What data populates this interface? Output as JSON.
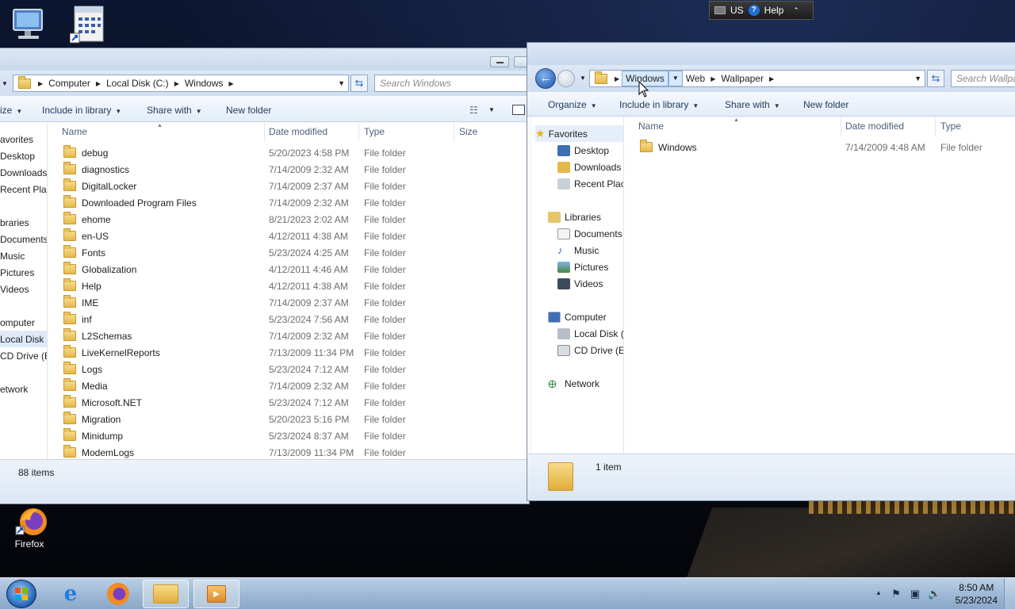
{
  "desktop": {
    "icons": [
      {
        "name": "computer-desktop-icon",
        "label": ""
      },
      {
        "name": "calendar-shortcut-icon",
        "label": ""
      },
      {
        "name": "firefox-desktop-icon",
        "label": "Firefox"
      }
    ]
  },
  "langbar": {
    "lang": "US",
    "help": "Help"
  },
  "left_window": {
    "breadcrumbs": [
      "Computer",
      "Local Disk (C:)",
      "Windows"
    ],
    "search_placeholder": "Search Windows",
    "toolbar": {
      "organize": "ize",
      "include": "Include in library",
      "share": "Share with",
      "new_folder": "New folder"
    },
    "columns": {
      "name": "Name",
      "date": "Date modified",
      "type": "Type",
      "size": "Size"
    },
    "nav": [
      "avorites",
      "Desktop",
      "Downloads",
      "Recent Plac",
      "braries",
      "Documents",
      "Music",
      "Pictures",
      "Videos",
      "omputer",
      "Local Disk (",
      "CD Drive (E:",
      "etwork"
    ],
    "rows": [
      {
        "name": "debug",
        "date": "5/20/2023 4:58 PM",
        "type": "File folder"
      },
      {
        "name": "diagnostics",
        "date": "7/14/2009 2:32 AM",
        "type": "File folder"
      },
      {
        "name": "DigitalLocker",
        "date": "7/14/2009 2:37 AM",
        "type": "File folder"
      },
      {
        "name": "Downloaded Program Files",
        "date": "7/14/2009 2:32 AM",
        "type": "File folder"
      },
      {
        "name": "ehome",
        "date": "8/21/2023 2:02 AM",
        "type": "File folder"
      },
      {
        "name": "en-US",
        "date": "4/12/2011 4:38 AM",
        "type": "File folder"
      },
      {
        "name": "Fonts",
        "date": "5/23/2024 4:25 AM",
        "type": "File folder"
      },
      {
        "name": "Globalization",
        "date": "4/12/2011 4:46 AM",
        "type": "File folder"
      },
      {
        "name": "Help",
        "date": "4/12/2011 4:38 AM",
        "type": "File folder"
      },
      {
        "name": "IME",
        "date": "7/14/2009 2:37 AM",
        "type": "File folder"
      },
      {
        "name": "inf",
        "date": "5/23/2024 7:56 AM",
        "type": "File folder"
      },
      {
        "name": "L2Schemas",
        "date": "7/14/2009 2:32 AM",
        "type": "File folder"
      },
      {
        "name": "LiveKernelReports",
        "date": "7/13/2009 11:34 PM",
        "type": "File folder"
      },
      {
        "name": "Logs",
        "date": "5/23/2024 7:12 AM",
        "type": "File folder"
      },
      {
        "name": "Media",
        "date": "7/14/2009 2:32 AM",
        "type": "File folder"
      },
      {
        "name": "Microsoft.NET",
        "date": "5/23/2024 7:12 AM",
        "type": "File folder"
      },
      {
        "name": "Migration",
        "date": "5/20/2023 5:16 PM",
        "type": "File folder"
      },
      {
        "name": "Minidump",
        "date": "5/23/2024 8:37 AM",
        "type": "File folder"
      },
      {
        "name": "ModemLogs",
        "date": "7/13/2009 11:34 PM",
        "type": "File folder"
      }
    ],
    "status": "88 items"
  },
  "right_window": {
    "breadcrumbs": [
      "Windows",
      "Web",
      "Wallpaper"
    ],
    "search_placeholder": "Search Wallpa",
    "toolbar": {
      "organize": "Organize",
      "include": "Include in library",
      "share": "Share with",
      "new_folder": "New folder"
    },
    "columns": {
      "name": "Name",
      "date": "Date modified",
      "type": "Type"
    },
    "nav": {
      "favorites": "Favorites",
      "fav_items": [
        "Desktop",
        "Downloads",
        "Recent Plac"
      ],
      "libraries": "Libraries",
      "lib_items": [
        "Documents",
        "Music",
        "Pictures",
        "Videos"
      ],
      "computer": "Computer",
      "comp_items": [
        "Local Disk (",
        "CD Drive (E:"
      ],
      "network": "Network"
    },
    "rows": [
      {
        "name": "Windows",
        "date": "7/14/2009 4:48 AM",
        "type": "File folder"
      }
    ],
    "status": "1 item"
  },
  "taskbar": {
    "apps": [
      "internet-explorer",
      "firefox",
      "windows-explorer",
      "media-player"
    ],
    "clock_time": "8:50 AM",
    "clock_date": "5/23/2024"
  }
}
